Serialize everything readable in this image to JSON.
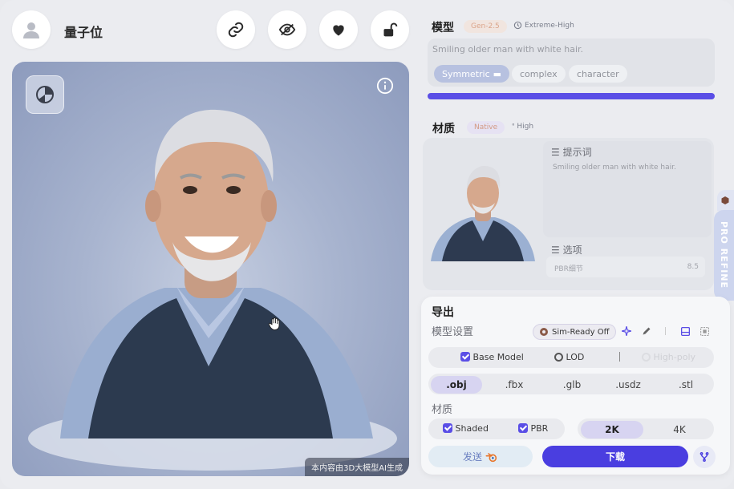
{
  "header": {
    "username": "量子位"
  },
  "preview": {
    "watermark": "本内容由3D大模型AI生成"
  },
  "model": {
    "title": "模型",
    "gen_tag": "Gen-2.5",
    "quality_tag": "Extreme-High",
    "prompt": "Smiling older man with white hair.",
    "chips": [
      "Symmetric",
      "complex",
      "character"
    ]
  },
  "material": {
    "title": "材质",
    "native_tag": "Native",
    "quality_tag": "High",
    "prompt_label": "提示词",
    "prompt": "Smiling older man with white hair.",
    "options_label": "选项",
    "pbr_label": "PBR细节",
    "pbr_value": "8.5"
  },
  "pro_refine": "PRO REFINE",
  "export": {
    "title": "导出",
    "model_settings": "模型设置",
    "sim_ready": "Sim-Ready Off",
    "base_model": "Base Model",
    "lod": "LOD",
    "high_poly": "High-poly",
    "formats": [
      ".obj",
      ".fbx",
      ".glb",
      ".usdz",
      ".stl"
    ],
    "material_label": "材质",
    "shaded": "Shaded",
    "pbr": "PBR",
    "res_2k": "2K",
    "res_4k": "4K",
    "send": "发送",
    "download": "下载"
  },
  "colors": {
    "accent": "#4a3ee0",
    "progress": "#5a4ee6"
  }
}
